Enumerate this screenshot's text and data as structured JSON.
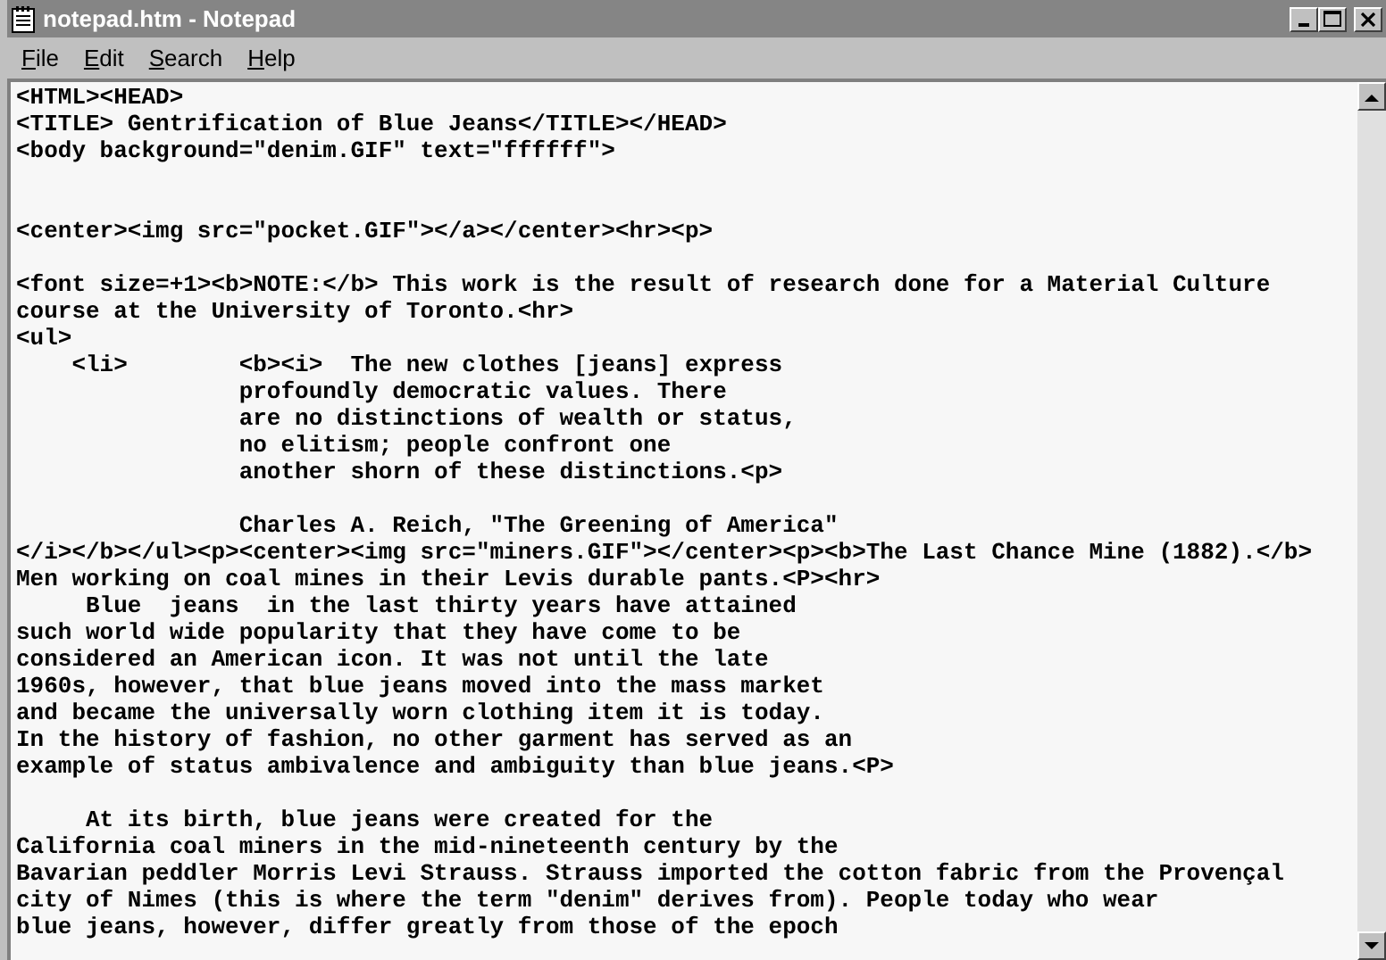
{
  "window": {
    "title": "notepad.htm - Notepad"
  },
  "menu": [
    {
      "label": "File"
    },
    {
      "label": "Edit"
    },
    {
      "label": "Search"
    },
    {
      "label": "Help"
    }
  ],
  "lines": [
    {
      "kind": "text",
      "text": "<HTML><HEAD>"
    },
    {
      "kind": "text",
      "text": "<TITLE> Gentrification of Blue Jeans</TITLE></HEAD>"
    },
    {
      "kind": "text",
      "text": "<body background=\"denim.GIF\" text=\"ffffff\">"
    },
    {
      "kind": "blank"
    },
    {
      "kind": "blank"
    },
    {
      "kind": "text",
      "text": "<center><img src=\"pocket.GIF\"></a></center><hr><p>"
    },
    {
      "kind": "blank"
    },
    {
      "kind": "text",
      "text": "<font size=+1><b>NOTE:</b> This work is the result of research done for a Material Culture"
    },
    {
      "kind": "text",
      "text": "course at the University of Toronto.<hr>"
    },
    {
      "kind": "text",
      "text": "<ul>"
    },
    {
      "kind": "text",
      "text": "    <li>        <b><i>  The new clothes [jeans] express"
    },
    {
      "kind": "text",
      "text": "                profoundly democratic values. There"
    },
    {
      "kind": "text",
      "text": "                are no distinctions of wealth or status,"
    },
    {
      "kind": "text",
      "text": "                no elitism; people confront one"
    },
    {
      "kind": "text",
      "text": "                another shorn of these distinctions.<p>"
    },
    {
      "kind": "blank"
    },
    {
      "kind": "text",
      "text": "                Charles A. Reich, \"The Greening of America\""
    },
    {
      "kind": "text",
      "text": "</i></b></ul><p><center><img src=\"miners.GIF\"></center><p><b>The Last Chance Mine (1882).</b>"
    },
    {
      "kind": "text",
      "text": "Men working on coal mines in their Levis durable pants.<P><hr>"
    },
    {
      "kind": "text",
      "text": "     Blue  jeans  in the last thirty years have attained"
    },
    {
      "kind": "text",
      "text": "such world wide popularity that they have come to be"
    },
    {
      "kind": "text",
      "text": "considered an American icon. It was not until the late"
    },
    {
      "kind": "text",
      "text": "1960s, however, that blue jeans moved into the mass market"
    },
    {
      "kind": "text",
      "text": "and became the universally worn clothing item it is today."
    },
    {
      "kind": "text",
      "text": "In the history of fashion, no other garment has served as an"
    },
    {
      "kind": "text",
      "text": "example of status ambivalence and ambiguity than blue jeans.<P>"
    },
    {
      "kind": "blank"
    },
    {
      "kind": "text",
      "text": "     At its birth, blue jeans were created for the"
    },
    {
      "kind": "text",
      "text": "California coal miners in the mid-nineteenth century by the"
    },
    {
      "kind": "text",
      "text": "Bavarian peddler Morris Levi Strauss. Strauss imported the cotton fabric from the Provençal"
    },
    {
      "kind": "text",
      "text": "city of Nimes (this is where the term \"denim\" derives from). People today who wear"
    },
    {
      "kind": "text",
      "text": "blue jeans, however, differ greatly from those of the epoch"
    }
  ]
}
